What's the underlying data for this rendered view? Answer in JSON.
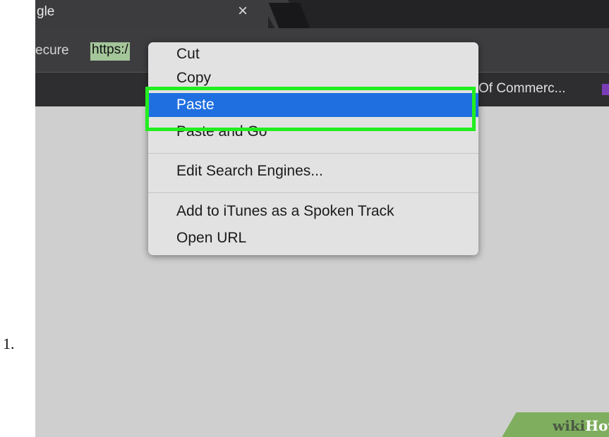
{
  "step_number": "1.",
  "tab": {
    "title": "gle",
    "close_label": "×"
  },
  "address_bar": {
    "secure_text": "ecure",
    "url_visible": "https:/"
  },
  "bookmarks": {
    "item": "Of Commerc..."
  },
  "context_menu": {
    "items": [
      {
        "label": "Cut",
        "selected": false
      },
      {
        "label": "Copy",
        "selected": false
      },
      {
        "label": "Paste",
        "selected": true
      },
      {
        "label": "Paste and Go",
        "selected": false
      },
      {
        "label": "Edit Search Engines...",
        "selected": false
      },
      {
        "label": "Add to iTunes as a Spoken Track",
        "selected": false
      },
      {
        "label": "Open URL",
        "selected": false
      }
    ]
  },
  "annotation": {
    "highlight_color": "#22ee1f",
    "target": "Paste"
  },
  "watermark": {
    "wiki": "wiki",
    "how": "How"
  }
}
